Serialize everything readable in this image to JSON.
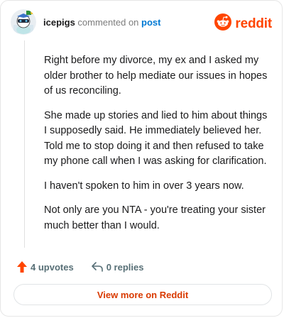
{
  "header": {
    "username": "icepigs",
    "commented_text": "commented on",
    "post_link": "post",
    "logo_text": "reddit",
    "avatar_icon": "snoo-avatar-icon",
    "logo_icon": "reddit-snoo-icon"
  },
  "comment": {
    "paragraphs": [
      "Right before my divorce, my ex and I asked my older brother to help mediate our issues in hopes of us reconciling.",
      "She made up stories and lied to him about things I supposedly said. He immediately believed her. Told me to stop doing it and then refused to take my phone call when I was asking for clarification.",
      "I haven't spoken to him in over 3 years now.",
      "Not only are you NTA - you're treating your sister much better than I would."
    ]
  },
  "actions": {
    "upvotes_label": "4 upvotes",
    "replies_label": "0 replies",
    "upvote_icon": "upvote-arrow-icon",
    "reply_icon": "reply-arrow-icon"
  },
  "footer": {
    "view_more_label": "View more on Reddit"
  },
  "colors": {
    "brand": "#ff4500",
    "link": "#0079d3",
    "view_more_text": "#d93a00",
    "meta_gray": "#7c7c7c"
  }
}
